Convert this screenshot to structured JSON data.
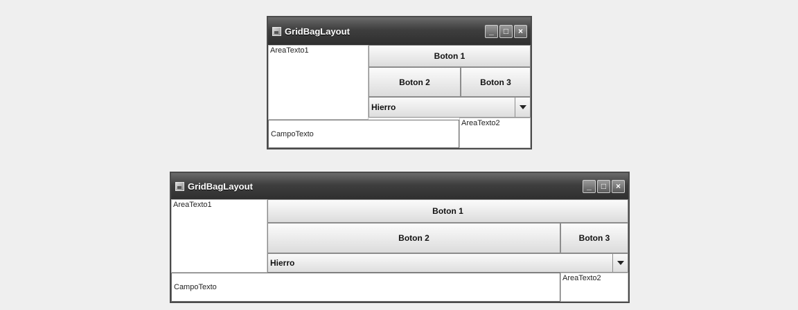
{
  "windows": [
    {
      "title": "GridBagLayout",
      "controls": {
        "minimize": "_",
        "maximize": "□",
        "close": "×"
      },
      "area1": "AreaTexto1",
      "button1": "Boton 1",
      "button2": "Boton 2",
      "button3": "Boton 3",
      "combo_value": "Hierro",
      "text_field": "CampoTexto",
      "area2": "AreaTexto2"
    },
    {
      "title": "GridBagLayout",
      "controls": {
        "minimize": "_",
        "maximize": "□",
        "close": "×"
      },
      "area1": "AreaTexto1",
      "button1": "Boton 1",
      "button2": "Boton 2",
      "button3": "Boton 3",
      "combo_value": "Hierro",
      "text_field": "CampoTexto",
      "area2": "AreaTexto2"
    }
  ]
}
